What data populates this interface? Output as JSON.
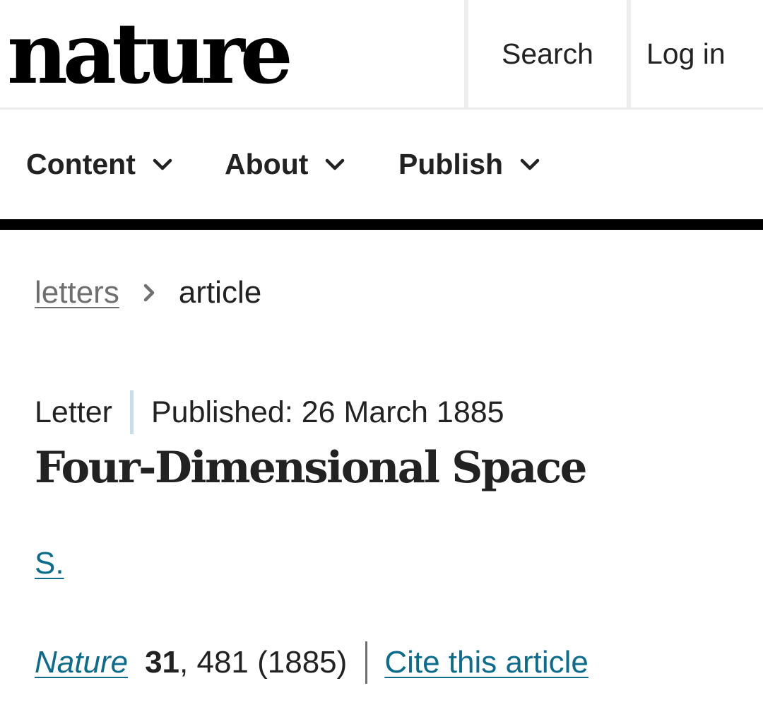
{
  "header": {
    "logo_text": "nature",
    "search_label": "Search",
    "login_label": "Log in"
  },
  "nav": {
    "items": [
      {
        "label": "Content",
        "icon": "chevron-down-icon"
      },
      {
        "label": "About",
        "icon": "chevron-down-icon"
      },
      {
        "label": "Publish",
        "icon": "chevron-down-icon"
      }
    ]
  },
  "breadcrumb": {
    "parent": "letters",
    "separator_icon": "chevron-right-icon",
    "current": "article"
  },
  "article": {
    "type": "Letter",
    "published": "Published: 26 March 1885",
    "title": "Four-Dimensional Space",
    "author": "S.",
    "citation": {
      "journal": "Nature",
      "volume": "31",
      "pages_year": ", 481 (1885)",
      "cite_label": "Cite this article"
    }
  },
  "colors": {
    "link": "#0c6c8c",
    "breadcrumb_link": "#6f6f6f",
    "text": "#222222",
    "nav_rule": "#000000",
    "meta_divider": "#c9dde6"
  }
}
